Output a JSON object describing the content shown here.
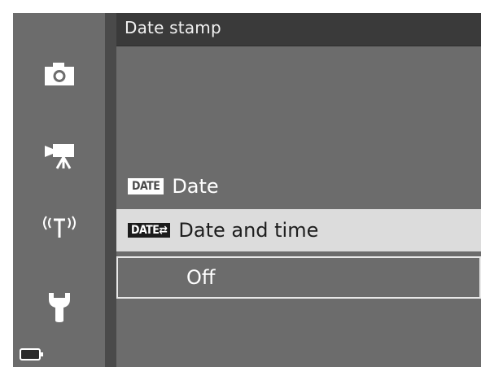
{
  "header": {
    "title": "Date stamp"
  },
  "sidebar": {
    "icons": [
      "camera-icon",
      "movie-camera-icon",
      "wireless-icon",
      "wrench-icon"
    ],
    "battery_icon": "battery-icon"
  },
  "menu": {
    "items": [
      {
        "badge": "DATE",
        "label": "Date",
        "selected": false
      },
      {
        "badge": "DATE⇄",
        "label": "Date and time",
        "selected": true
      },
      {
        "badge": "",
        "label": "Off",
        "selected": false,
        "current": true
      }
    ]
  },
  "colors": {
    "sidebar_bg": "#6c6c6c",
    "title_bar_bg": "#3a3a3a",
    "highlight_bg": "#dcdcdc",
    "menu_bg": "#6c6c6c"
  }
}
